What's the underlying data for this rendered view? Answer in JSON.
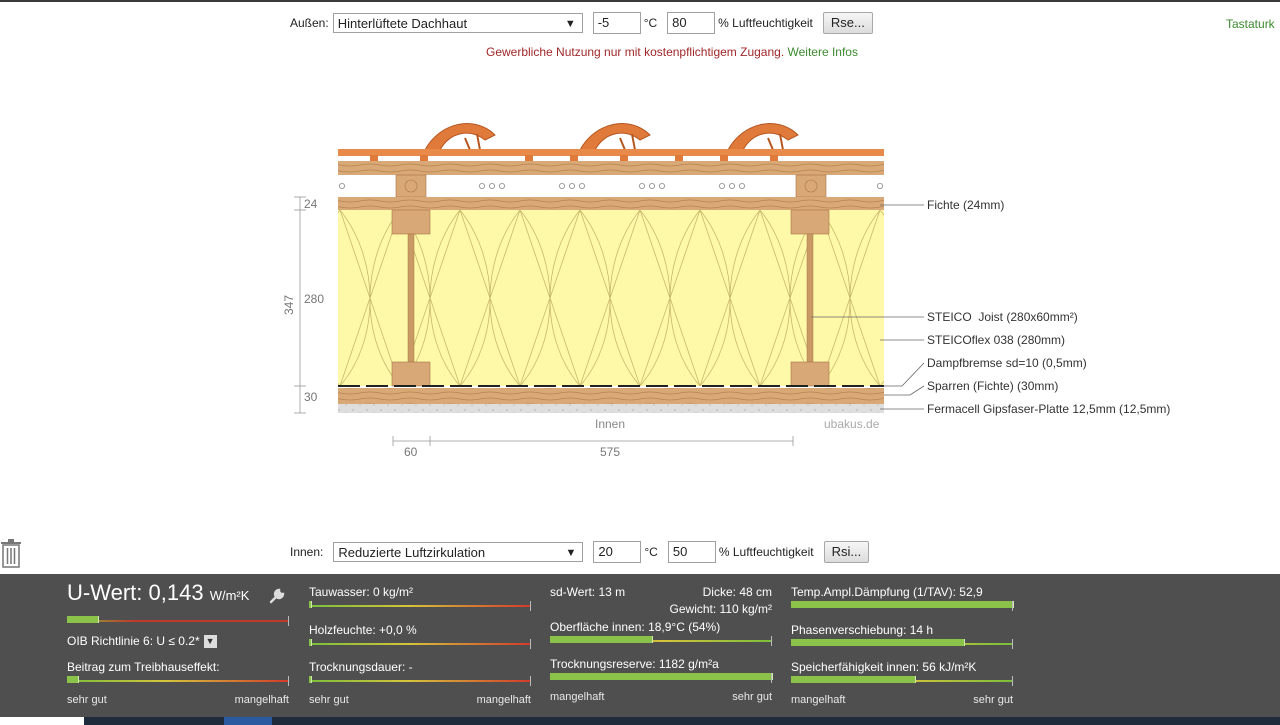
{
  "outside": {
    "label": "Außen:",
    "select_value": "Hinterlüftete Dachhaut",
    "temperature": "-5",
    "temp_unit": "°C",
    "humidity": "80",
    "humidity_unit": "% Luftfeuchtigkeit",
    "button": "Rse..."
  },
  "notice": {
    "text": "Gewerbliche Nutzung nur mit kostenpflichtigem Zugang.",
    "link": "Weitere Infos"
  },
  "tastatur": "Tastaturk",
  "diagram": {
    "dim_top": "24",
    "dim_mid": "280",
    "dim_total": "347",
    "dim_bot": "30",
    "dim_left": "60",
    "dim_span": "575",
    "inner_label": "Innen",
    "watermark": "ubakus.de",
    "layers": [
      "Fichte (24mm)",
      "STEICO  Joist (280x60mm²)",
      "STEICOflex 038 (280mm)",
      "Dampfbremse sd=10 (0,5mm)",
      "Sparren (Fichte) (30mm)",
      "Fermacell Gipsfaser-Platte 12,5mm (12,5mm)"
    ]
  },
  "inside": {
    "label": "Innen:",
    "select_value": "Reduzierte Luftzirkulation",
    "temperature": "20",
    "temp_unit": "°C",
    "humidity": "50",
    "humidity_unit": "% Luftfeuchtigkeit",
    "button": "Rsi..."
  },
  "results": {
    "u_label": "U-Wert:",
    "u_value": "0,143",
    "u_unit": "W/m²K",
    "u_bar": 0.14,
    "oib": "OIB Richtlinie 6: U ≤ 0.2*",
    "treibhaus": "Beitrag zum Treibhauseffekt:",
    "treibhaus_bar": 0.05,
    "scale_good": "sehr gut",
    "scale_bad": "mangelhaft",
    "tauwasser": "Tauwasser: 0 kg/m²",
    "tauwasser_bar": 0.01,
    "holzfeuchte": "Holzfeuchte: +0,0 %",
    "holzfeuchte_bar": 0.01,
    "trocknung": "Trocknungsdauer: -",
    "trocknung_bar": 0.01,
    "sd": "sd-Wert: 13 m",
    "dicke": "Dicke: 48 cm",
    "gewicht": "Gewicht: 110 kg/m²",
    "oberflaeche": "Oberfläche innen: 18,9°C (54%)",
    "oberflaeche_bar": 0.46,
    "reserve": "Trocknungsreserve: 1182 g/m²a",
    "reserve_bar": 1.0,
    "temp_amp": "Temp.Ampl.Dämpfung (1/TAV): 52,9",
    "temp_amp_bar": 1.0,
    "phase": "Phasenverschiebung: 14 h",
    "phase_bar": 0.78,
    "speicher": "Speicherfähigkeit innen: 56 kJ/m²K",
    "speicher_bar": 0.56
  },
  "colors": {
    "panel": "#4f4f4f",
    "good_green": "#8bc34a",
    "notice_red": "#a0282a",
    "link_green": "#3b8a2e",
    "insulation": "#fef9a8",
    "wood": "#d9a877",
    "tile": "#e07a3a"
  },
  "icons": [
    "dropdown-arrow-icon",
    "wrench-icon",
    "trash-icon",
    "chevron-down-icon"
  ]
}
